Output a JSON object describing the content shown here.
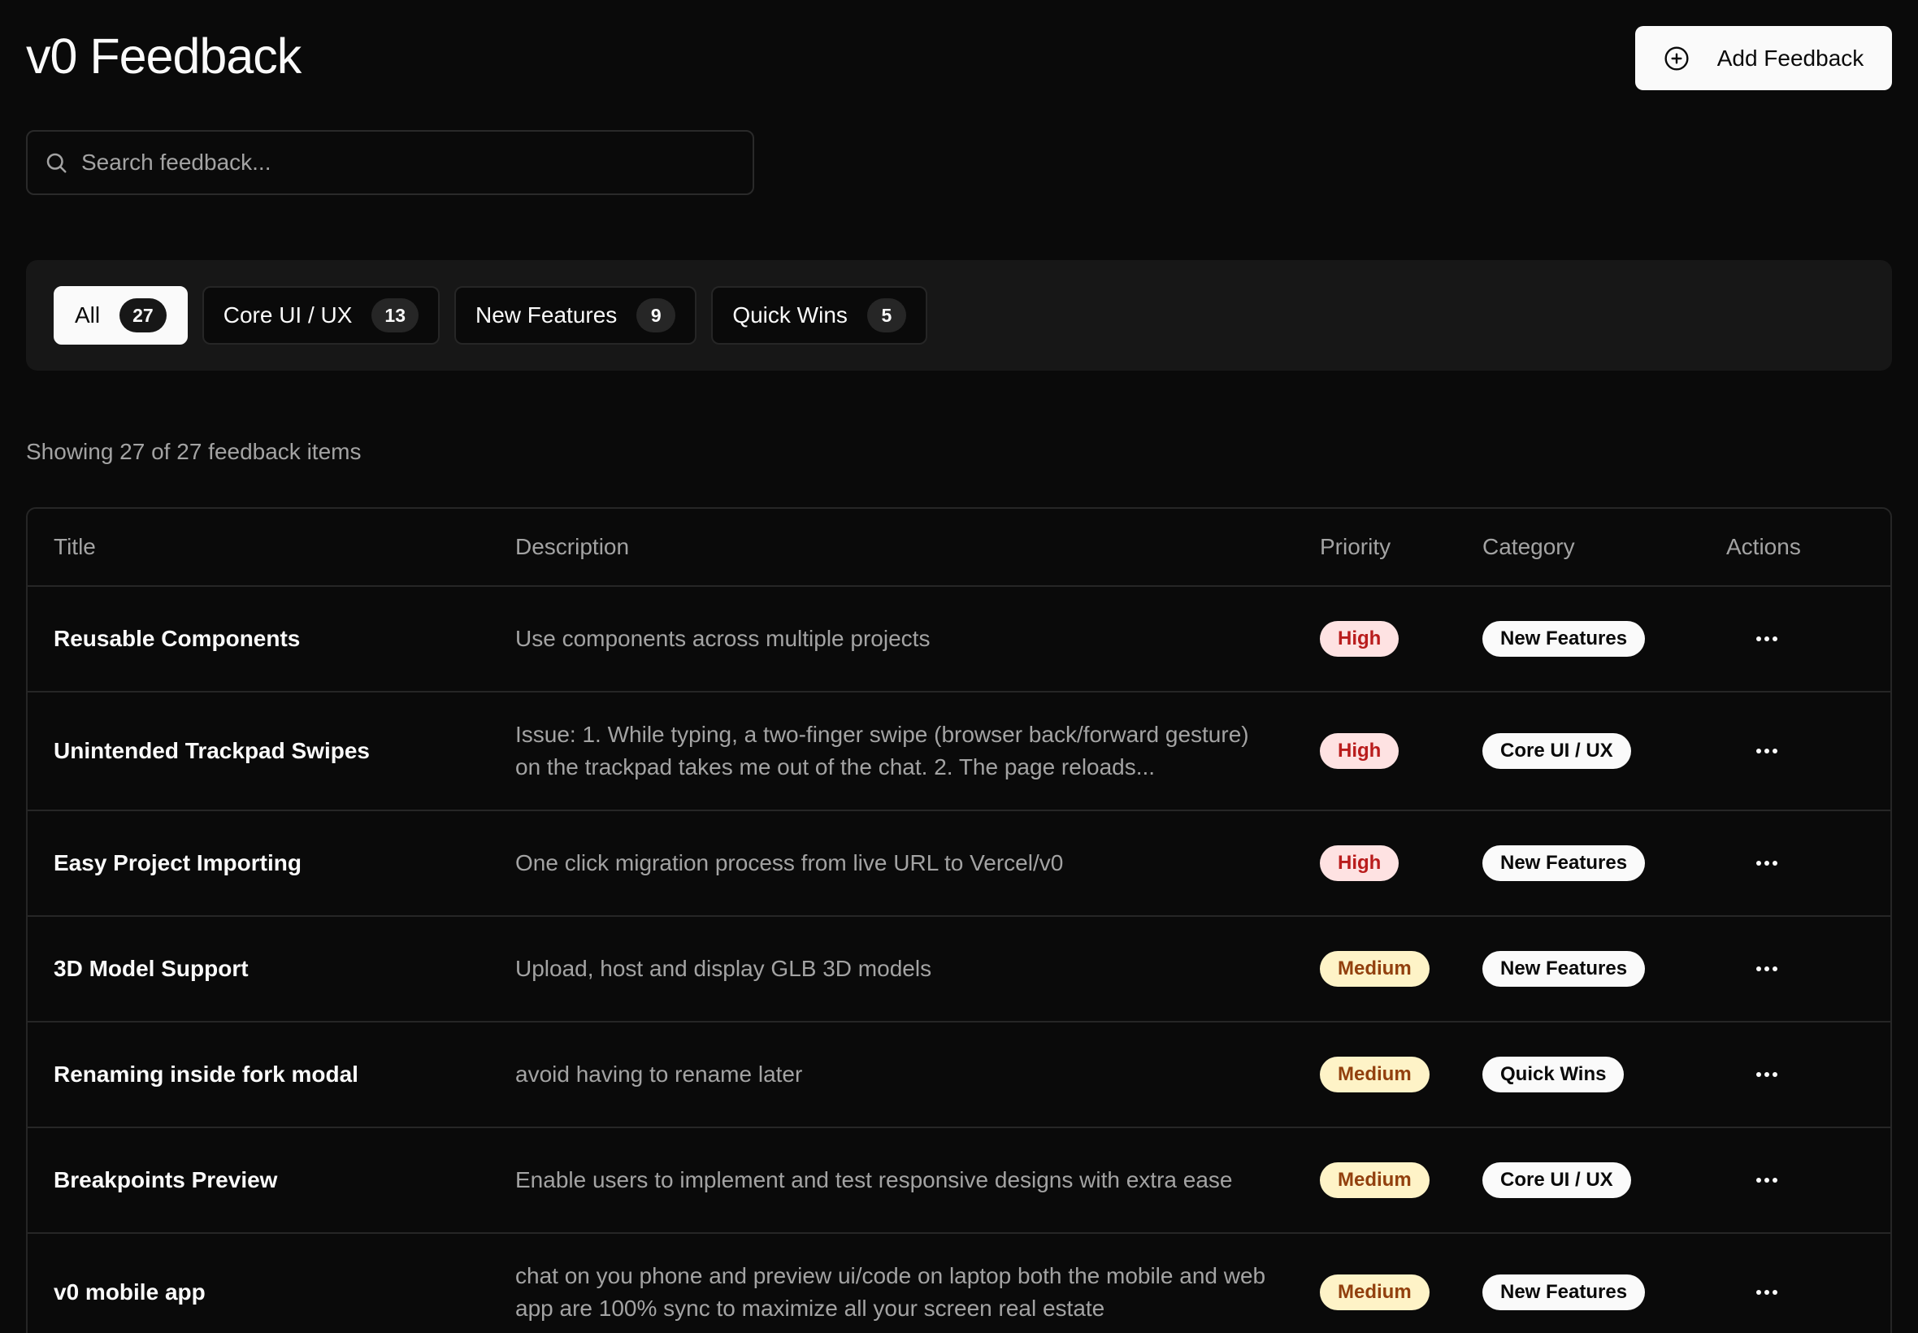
{
  "header": {
    "title": "v0 Feedback",
    "add_label": "Add Feedback"
  },
  "search": {
    "placeholder": "Search feedback...",
    "value": ""
  },
  "tabs": [
    {
      "label": "All",
      "count": "27",
      "active": true
    },
    {
      "label": "Core UI / UX",
      "count": "13",
      "active": false
    },
    {
      "label": "New Features",
      "count": "9",
      "active": false
    },
    {
      "label": "Quick Wins",
      "count": "5",
      "active": false
    }
  ],
  "summary": "Showing 27 of 27 feedback items",
  "table": {
    "columns": [
      "Title",
      "Description",
      "Priority",
      "Category",
      "Actions"
    ],
    "rows": [
      {
        "title": "Reusable Components",
        "description": "Use components across multiple projects",
        "priority": "High",
        "category": "New Features"
      },
      {
        "title": "Unintended Trackpad Swipes",
        "description": "Issue: 1. While typing, a two-finger swipe (browser back/forward gesture) on the trackpad takes me out of the chat. 2. The page reloads...",
        "priority": "High",
        "category": "Core UI / UX"
      },
      {
        "title": "Easy Project Importing",
        "description": "One click migration process from live URL to Vercel/v0",
        "priority": "High",
        "category": "New Features"
      },
      {
        "title": "3D Model Support",
        "description": "Upload, host and display GLB 3D models",
        "priority": "Medium",
        "category": "New Features"
      },
      {
        "title": "Renaming inside fork modal",
        "description": "avoid having to rename later",
        "priority": "Medium",
        "category": "Quick Wins"
      },
      {
        "title": "Breakpoints Preview",
        "description": "Enable users to implement and test responsive designs with extra ease",
        "priority": "Medium",
        "category": "Core UI / UX"
      },
      {
        "title": "v0 mobile app",
        "description": "chat on you phone and preview ui/code on laptop both the mobile and web app are 100% sync to maximize all your screen real estate",
        "priority": "Medium",
        "category": "New Features"
      }
    ]
  },
  "colors": {
    "background": "#0a0a0a",
    "panel": "#171717",
    "high_bg": "#fee2e2",
    "high_text": "#b91c1c",
    "medium_bg": "#fef3c7",
    "medium_text": "#92400e"
  },
  "icons": {
    "add": "plus-circle-icon",
    "search": "search-icon",
    "actions": "more-horizontal-icon"
  }
}
